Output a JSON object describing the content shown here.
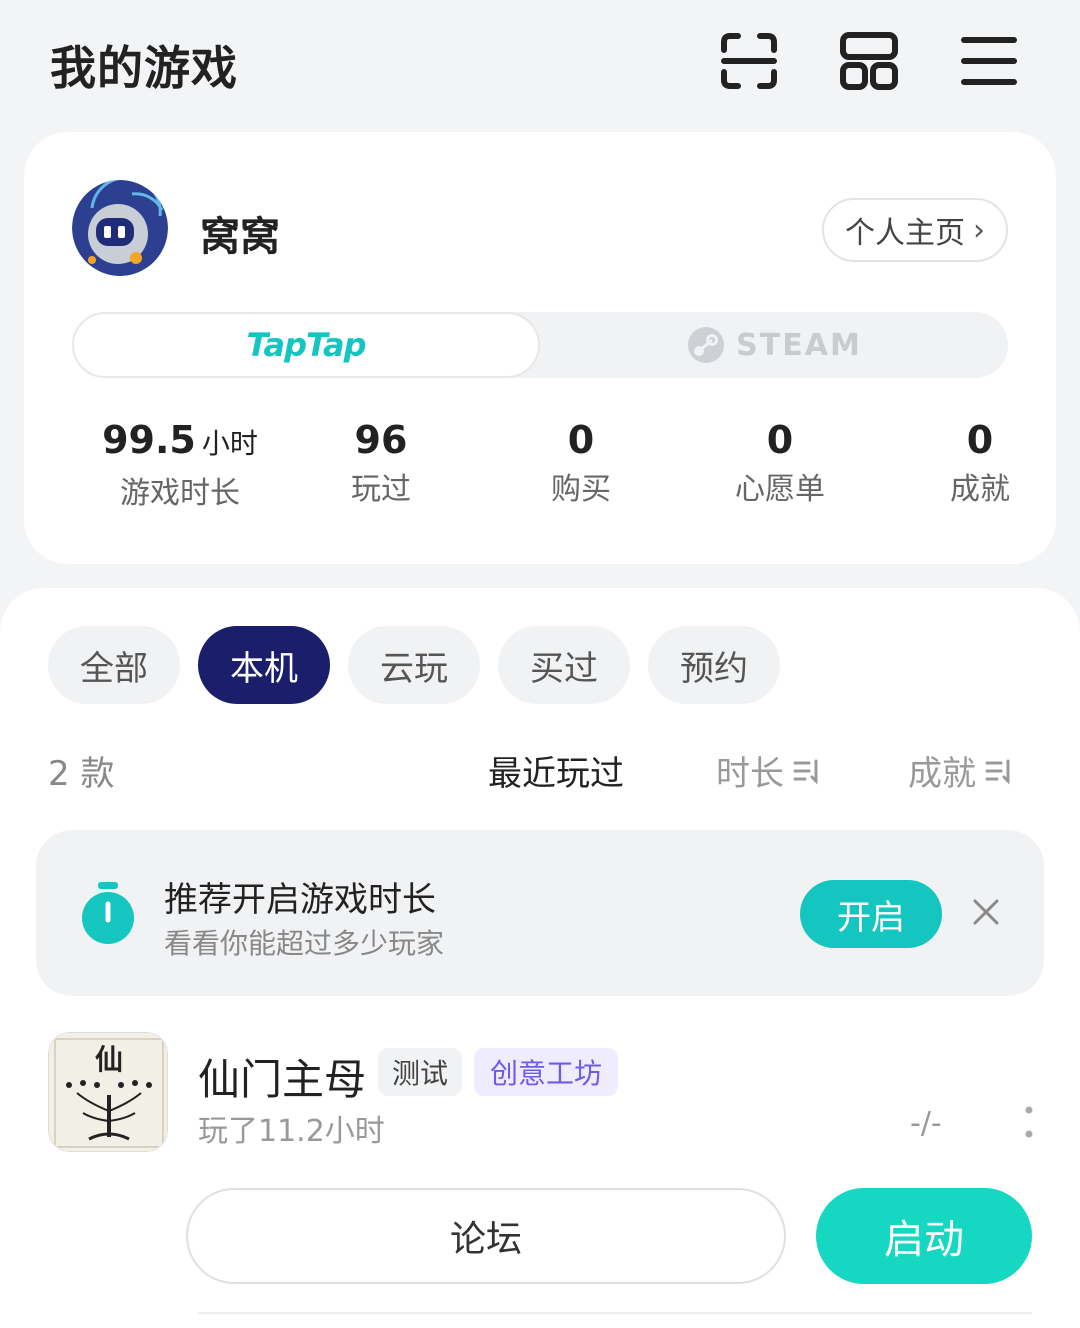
{
  "header": {
    "title": "我的游戏",
    "icons": [
      "scan-icon",
      "grid-layout-icon",
      "menu-icon"
    ]
  },
  "profile": {
    "username": "窝窝",
    "homepage_label": "个人主页",
    "platforms": {
      "taptap_label": "TapTap",
      "steam_label": "STEAM",
      "selected": "TapTap"
    },
    "stats": [
      {
        "value": "99.5",
        "unit": "小时",
        "label": "游戏时长"
      },
      {
        "value": "96",
        "unit": "",
        "label": "玩过"
      },
      {
        "value": "0",
        "unit": "",
        "label": "购买"
      },
      {
        "value": "0",
        "unit": "",
        "label": "心愿单"
      },
      {
        "value": "0",
        "unit": "",
        "label": "成就"
      }
    ]
  },
  "filters": {
    "chips": [
      "全部",
      "本机",
      "云玩",
      "买过",
      "预约"
    ],
    "active": "本机"
  },
  "list_header": {
    "count": "2 款",
    "sort_options": [
      "最近玩过",
      "时长",
      "成就"
    ],
    "active_sort": "最近玩过"
  },
  "banner": {
    "title": "推荐开启游戏时长",
    "subtitle": "看看你能超过多少玩家",
    "button": "开启"
  },
  "games": [
    {
      "name": "仙门主母",
      "tags": [
        "测试",
        "创意工坊"
      ],
      "playtime": "玩了11.2小时",
      "achievements": "-/-",
      "forum_label": "论坛",
      "launch_label": "启动",
      "icon_glyph": "仙"
    }
  ],
  "colors": {
    "accent": "#15C5C0",
    "launch": "#15D7C2",
    "active_chip": "#1B1F6B",
    "workshop_tag": "#6E5BE8",
    "background": "#F3F4F6"
  }
}
